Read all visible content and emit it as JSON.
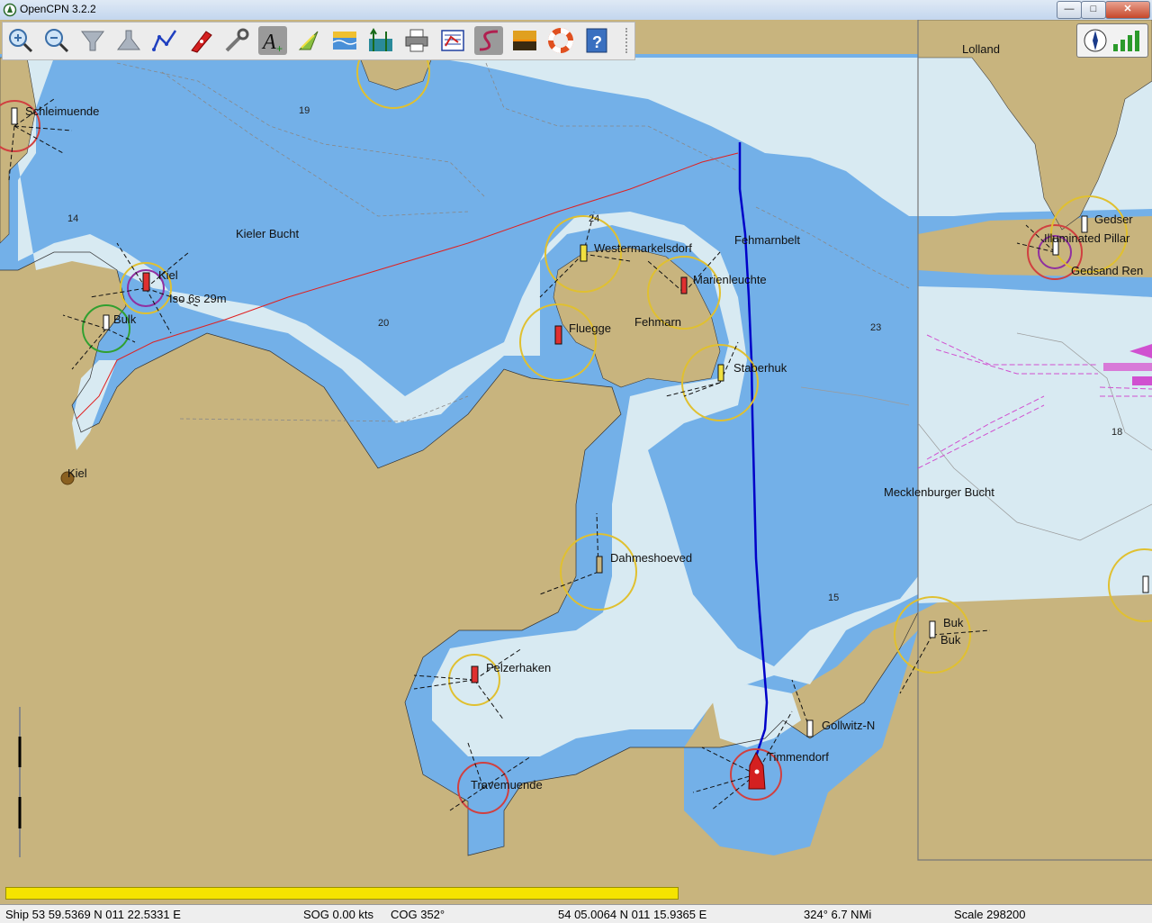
{
  "window": {
    "title": "OpenCPN 3.2.2",
    "minimize_glyph": "—",
    "maximize_glyph": "□",
    "close_glyph": "✕"
  },
  "toolbar": {
    "buttons": [
      {
        "name": "zoom-in",
        "tooltip": "Zoom In"
      },
      {
        "name": "zoom-out",
        "tooltip": "Zoom Out"
      },
      {
        "name": "scale-in",
        "tooltip": "Shift to Larger Scale Chart"
      },
      {
        "name": "scale-out",
        "tooltip": "Shift to Smaller Scale Chart"
      },
      {
        "name": "create-route",
        "tooltip": "Create Route"
      },
      {
        "name": "auto-follow",
        "tooltip": "Auto Follow"
      },
      {
        "name": "settings",
        "tooltip": "Options"
      },
      {
        "name": "text",
        "tooltip": "Show ENC Text"
      },
      {
        "name": "current",
        "tooltip": "Show Currents"
      },
      {
        "name": "tide",
        "tooltip": "Show Tides"
      },
      {
        "name": "route-manager",
        "tooltip": "Route & Mark Manager"
      },
      {
        "name": "print",
        "tooltip": "Print Chart"
      },
      {
        "name": "track",
        "tooltip": "Enable Tracking"
      },
      {
        "name": "color-scheme",
        "tooltip": "Change Color Scheme"
      },
      {
        "name": "mob",
        "tooltip": "Drop MOB Marker"
      },
      {
        "name": "help",
        "tooltip": "About OpenCPN"
      }
    ]
  },
  "chart": {
    "places": [
      {
        "id": "schleimuende",
        "text": "Schleimuende"
      },
      {
        "id": "kieler-bucht",
        "text": "Kieler Bucht"
      },
      {
        "id": "kiel-light",
        "text": "Kiel"
      },
      {
        "id": "kiel-light-char",
        "text": "Iso 6s 29m"
      },
      {
        "id": "bulk",
        "text": "Bulk"
      },
      {
        "id": "kiel-city",
        "text": "Kiel"
      },
      {
        "id": "westermarkelsdorf",
        "text": "Westermarkelsdorf"
      },
      {
        "id": "marienleuchte",
        "text": "Marienleuchte"
      },
      {
        "id": "fehmarnbelt",
        "text": "Fehmarnbelt"
      },
      {
        "id": "fluegge",
        "text": "Fluegge"
      },
      {
        "id": "fehmarn",
        "text": "Fehmarn"
      },
      {
        "id": "staberhuk",
        "text": "Staberhuk"
      },
      {
        "id": "lolland",
        "text": "Lolland"
      },
      {
        "id": "gedser",
        "text": "Gedser"
      },
      {
        "id": "illuminated-pillar",
        "text": "Illuminated Pillar"
      },
      {
        "id": "gedsand",
        "text": "Gedsand Ren"
      },
      {
        "id": "mecklenburger",
        "text": "Mecklenburger Bucht"
      },
      {
        "id": "dahmeshoeved",
        "text": "Dahmeshoeved"
      },
      {
        "id": "pelzerhaken",
        "text": "Pelzerhaken"
      },
      {
        "id": "travemuende",
        "text": "Travemuende"
      },
      {
        "id": "timmendorf",
        "text": "Timmendorf"
      },
      {
        "id": "gollwitz",
        "text": "Gollwitz-N"
      },
      {
        "id": "buk1",
        "text": "Buk"
      },
      {
        "id": "buk2",
        "text": "Buk"
      }
    ],
    "depths": [
      "19",
      "14",
      "20",
      "24",
      "23",
      "18",
      "15"
    ],
    "colors": {
      "land": "#c8b47e",
      "deep_water": "#d8eaf2",
      "shallow_water": "#73b0e8",
      "route": "#0000c8",
      "track": "#e02020",
      "ship": "#d42020",
      "traffic_lane": "#d050d0"
    }
  },
  "progress": {
    "value": 0.59
  },
  "status": {
    "ship_position": "Ship 53 59.5369 N   011 22.5331 E",
    "sog": "SOG 0.00 kts",
    "cog": "COG 352°",
    "cursor_position": "54 05.0064 N   011 15.9365 E",
    "bearing_distance": "324°   6.7 NMi",
    "scale": "Scale 298200"
  }
}
